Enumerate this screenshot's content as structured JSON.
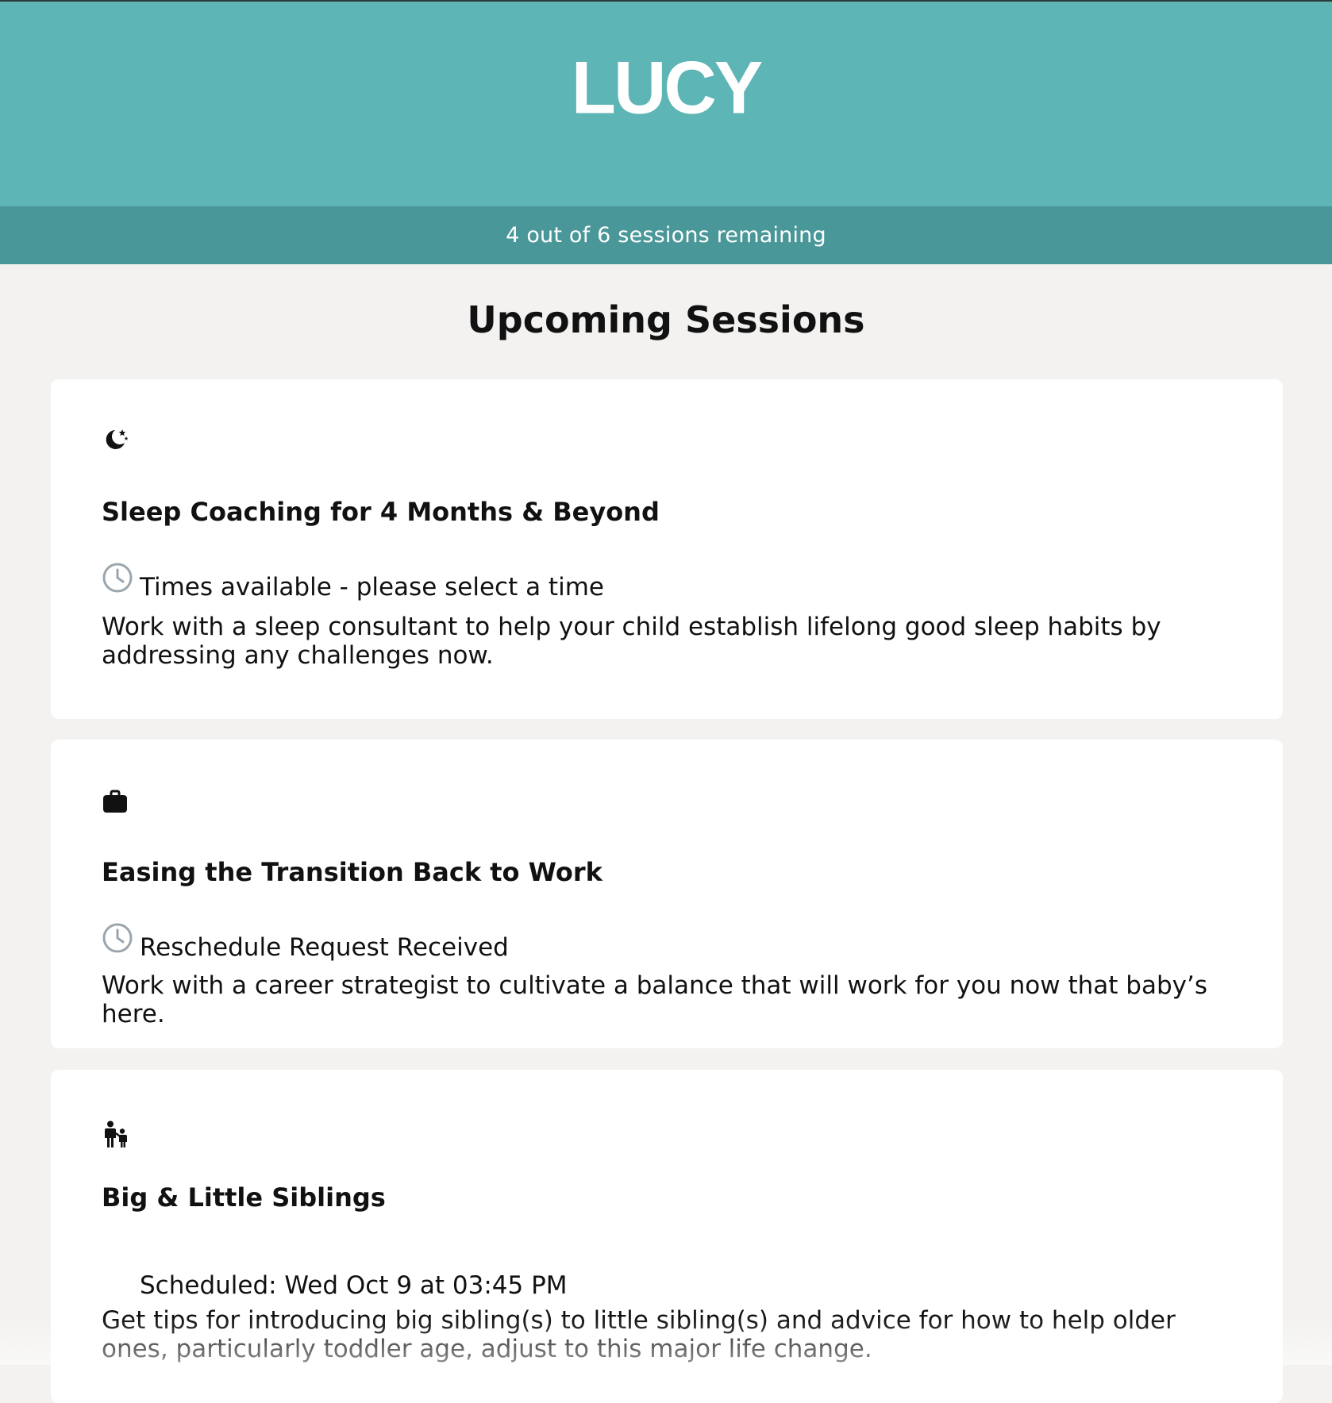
{
  "brand": {
    "logo_text": "LUCY",
    "header_color": "#5eb5b6",
    "bar_color": "#4a9799"
  },
  "sessions_remaining_text": "4 out of 6 sessions remaining",
  "page_title": "Upcoming Sessions",
  "sessions": [
    {
      "icon": "moon-stars-icon",
      "title": "Sleep Coaching for 4 Months & Beyond",
      "status_icon": "clock-icon",
      "status": "Times available - please select a time",
      "description": "Work with a sleep consultant to help your child establish lifelong good sleep habits by addressing any challenges now."
    },
    {
      "icon": "briefcase-icon",
      "title": "Easing the Transition Back to Work",
      "status_icon": "clock-icon",
      "status": "Reschedule Request Received",
      "description": "Work with a career strategist to cultivate a balance that will work for you now that baby’s here."
    },
    {
      "icon": "parent-child-icon",
      "title": "Big & Little Siblings",
      "status": "Scheduled: Wed Oct 9 at 03:45 PM",
      "description": "Get tips for introducing big sibling(s) to little sibling(s) and advice for how to help older ones, particularly toddler age, adjust to this major life change."
    }
  ]
}
